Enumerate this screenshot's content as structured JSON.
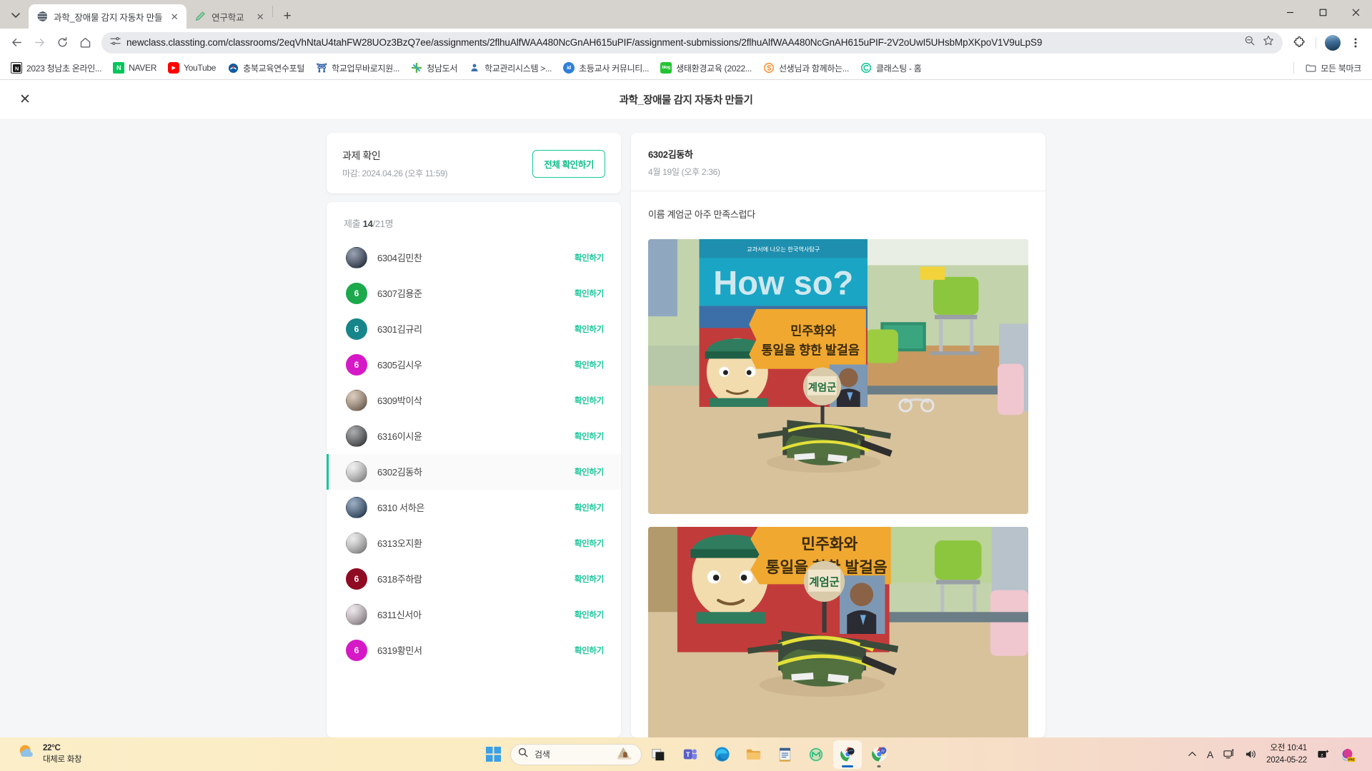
{
  "browser": {
    "tabs": [
      {
        "title": "과학_장애물 감지 자동차 만들",
        "favicon": "globe-icon",
        "active": true
      },
      {
        "title": "연구학교",
        "favicon": "pencil-icon",
        "active": false
      }
    ],
    "tab_close_label": "✕",
    "new_tab_label": "+",
    "nav": {
      "back": "←",
      "forward": "→",
      "reload": "⟳",
      "home": "⌂"
    },
    "omnibox": {
      "url": "newclass.classting.com/classrooms/2eqVhNtaU4tahFW28UOz3BzQ7ee/assignments/2flhuAlfWAA480NcGnAH615uPIF/assignment-submissions/2flhuAlfWAA480NcGnAH615uPIF-2V2oUwI5UHsbMpXKpoV1V9uLpS9",
      "site_info_icon": "tune-icon",
      "zoom_icon": "zoom-out-icon",
      "bookmark_icon": "star-icon"
    },
    "extensions_icon": "puzzle-icon",
    "profile_icon": "avatar",
    "menu_icon": "kebab-menu-icon",
    "window_controls": {
      "minimize": "—",
      "maximize": "▢",
      "close": "✕"
    },
    "bookmarks": [
      {
        "label": "2023 청남초 온라인...",
        "icon_text": "N",
        "icon_color": "#ffffff"
      },
      {
        "label": "NAVER",
        "icon_text": "N",
        "icon_color": "#03c75a"
      },
      {
        "label": "YouTube",
        "icon_text": "▶",
        "icon_color": "#ff0000"
      },
      {
        "label": "충북교육연수포털",
        "icon_text": "◉",
        "icon_color": "#0b5fa5"
      },
      {
        "label": "학교업무바로지원...",
        "icon_text": "⛩",
        "icon_color": "#2b5ca8"
      },
      {
        "label": "청남도서",
        "icon_text": "✛",
        "icon_color": "#59b84a"
      },
      {
        "label": "학교관리시스템 >...",
        "icon_text": "⚘",
        "icon_color": "#3a6fb0"
      },
      {
        "label": "초등교사 커뮤니티...",
        "icon_text": "id",
        "icon_color": "#2f7fd8"
      },
      {
        "label": "생태환경교육 (2022...",
        "icon_text": "blog",
        "icon_color": "#21c531"
      },
      {
        "label": "선생님과 함께하는...",
        "icon_text": "S",
        "icon_color": "#ff8c2e"
      },
      {
        "label": "클래스팅 - 홈",
        "icon_text": "C",
        "icon_color": "#15c79a"
      }
    ],
    "all_bookmarks_label": "모든 북마크",
    "all_bookmarks_icon": "folder-icon"
  },
  "modal": {
    "close_label": "✕",
    "title": "과학_장애물 감지 자동차 만들기"
  },
  "assignment": {
    "title": "과제 확인",
    "due": "마감: 2024.04.26 (오후 11:59)",
    "check_all_button": "전체 확인하기"
  },
  "submissions": {
    "count_prefix": "제출 ",
    "count_submitted": "14",
    "count_total": "/21명",
    "action_label": "확인하기",
    "students": [
      {
        "name": "6304김민찬",
        "avatar_type": "photo",
        "avatar_color": "#2b3f63",
        "initial": ""
      },
      {
        "name": "6307김용준",
        "avatar_type": "initial",
        "avatar_color": "#1ba94c",
        "initial": "6"
      },
      {
        "name": "6301김규리",
        "avatar_type": "initial",
        "avatar_color": "#17868a",
        "initial": "6"
      },
      {
        "name": "6305김시우",
        "avatar_type": "initial",
        "avatar_color": "#d619c6",
        "initial": "6"
      },
      {
        "name": "6309박이삭",
        "avatar_type": "photo",
        "avatar_color": "#c8a584",
        "initial": ""
      },
      {
        "name": "6316이시윤",
        "avatar_type": "photo",
        "avatar_color": "#55595e",
        "initial": ""
      },
      {
        "name": "6302김동하",
        "avatar_type": "photo",
        "avatar_color": "#ffffff",
        "initial": "",
        "selected": true
      },
      {
        "name": "6310 서하은",
        "avatar_type": "photo",
        "avatar_color": "#2f5a8c",
        "initial": ""
      },
      {
        "name": "6313오지환",
        "avatar_type": "photo",
        "avatar_color": "#f2f2f2",
        "initial": ""
      },
      {
        "name": "6318주하람",
        "avatar_type": "initial",
        "avatar_color": "#8f0b22",
        "initial": "6"
      },
      {
        "name": "6311신서아",
        "avatar_type": "photo",
        "avatar_color": "#f7e6ef",
        "initial": ""
      },
      {
        "name": "6319황민서",
        "avatar_type": "initial",
        "avatar_color": "#d619c6",
        "initial": "6"
      }
    ]
  },
  "detail": {
    "student_name": "6302김동하",
    "submitted_at": "4월 19일 (오후 2:36)",
    "body_text": "이름 계엄군 아주 만족스럽다",
    "photos": [
      {
        "name": "submission-photo-1",
        "book_title_en": "How so?",
        "book_header": "교과서에 나오는 한국역사탐구",
        "book_subtitle_1": "민주화와",
        "book_subtitle_2": "통일을 향한 발걸음",
        "sign_text": "계엄군"
      },
      {
        "name": "submission-photo-2",
        "book_subtitle_1": "민주화와",
        "book_subtitle_2": "통일을 향한 발걸음",
        "sign_text": "계엄군"
      }
    ]
  },
  "taskbar": {
    "weather_temp": "22°C",
    "weather_desc": "대체로 화창",
    "search_placeholder": "검색",
    "apps": [
      {
        "name": "start-button",
        "label": "시작"
      },
      {
        "name": "task-view-button",
        "label": "작업 보기"
      },
      {
        "name": "teams-button",
        "label": "Teams"
      },
      {
        "name": "edge-button",
        "label": "Microsoft Edge"
      },
      {
        "name": "file-explorer-button",
        "label": "파일 탐색기"
      },
      {
        "name": "notepad-button",
        "label": "메모장"
      },
      {
        "name": "mega-button",
        "label": "MEGA"
      },
      {
        "name": "chrome-button",
        "label": "Chrome"
      },
      {
        "name": "chrome-profile-button",
        "label": "Chrome JY"
      }
    ],
    "tray": {
      "chevron": "⌃",
      "ime": "A",
      "network_icon": "network-icon",
      "volume_icon": "volume-icon",
      "notification_icon": "notification-icon",
      "copilot_icon": "copilot-icon"
    },
    "time": "오전 10:41",
    "date": "2024-05-22"
  }
}
